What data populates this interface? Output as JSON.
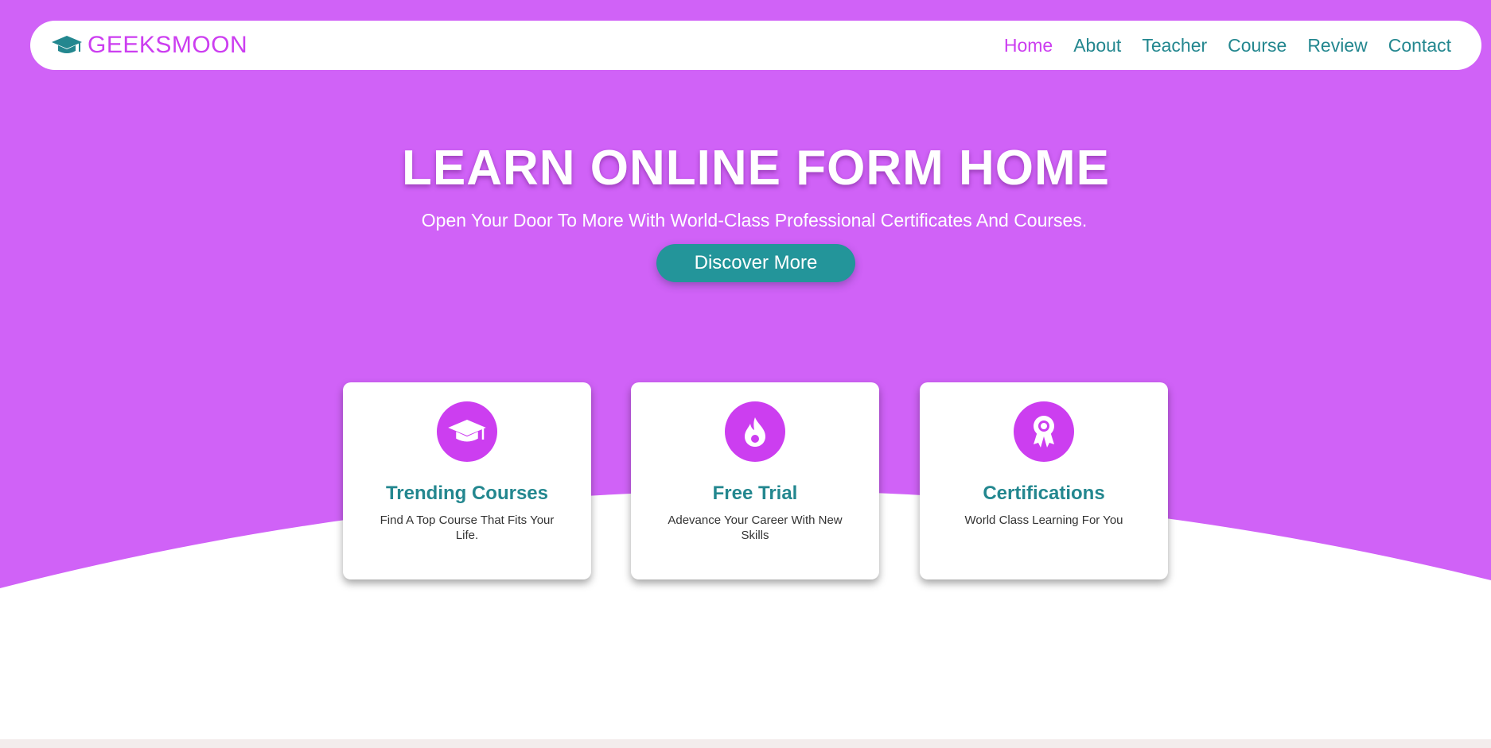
{
  "brand": {
    "name": "GEEKSMOON",
    "icon": "graduation-cap-icon"
  },
  "nav": {
    "items": [
      {
        "label": "Home",
        "active": true
      },
      {
        "label": "About"
      },
      {
        "label": "Teacher"
      },
      {
        "label": "Course"
      },
      {
        "label": "Review"
      },
      {
        "label": "Contact"
      }
    ]
  },
  "hero": {
    "title": "LEARN ONLINE FORM HOME",
    "subtitle": "Open Your Door To More With World-Class Professional Certificates And Courses.",
    "button_label": "Discover More"
  },
  "cards": [
    {
      "icon": "graduation-cap-icon",
      "title": "Trending Courses",
      "text": "Find A Top Course That Fits Your Life."
    },
    {
      "icon": "fire-icon",
      "title": "Free Trial",
      "text": "Adevance Your Career With New Skills"
    },
    {
      "icon": "award-icon",
      "title": "Certifications",
      "text": "World Class Learning For You"
    }
  ],
  "colors": {
    "hero_bg": "#d062f7",
    "accent_purple": "#cc3ef0",
    "accent_teal": "#23878f",
    "button_teal": "#23959a"
  }
}
